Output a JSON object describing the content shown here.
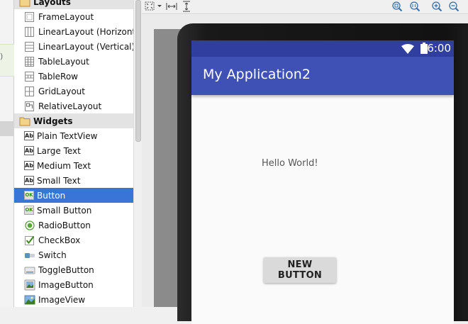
{
  "left_strip": {
    "fragment": ")"
  },
  "palette": {
    "rows": [
      {
        "label": "Layouts",
        "type": "group",
        "icon": "folder-icon"
      },
      {
        "label": "FrameLayout",
        "type": "item",
        "icon": "frame-layout-icon"
      },
      {
        "label": "LinearLayout (Horizonta",
        "type": "item",
        "icon": "linear-layout-horizontal-icon"
      },
      {
        "label": "LinearLayout (Vertical)",
        "type": "item",
        "icon": "linear-layout-vertical-icon"
      },
      {
        "label": "TableLayout",
        "type": "item",
        "icon": "table-layout-icon"
      },
      {
        "label": "TableRow",
        "type": "item",
        "icon": "table-row-icon"
      },
      {
        "label": "GridLayout",
        "type": "item",
        "icon": "grid-layout-icon"
      },
      {
        "label": "RelativeLayout",
        "type": "item",
        "icon": "relative-layout-icon"
      },
      {
        "label": "Widgets",
        "type": "group",
        "icon": "folder-icon"
      },
      {
        "label": "Plain TextView",
        "type": "item",
        "icon": "textview-icon"
      },
      {
        "label": "Large Text",
        "type": "item",
        "icon": "textview-icon"
      },
      {
        "label": "Medium Text",
        "type": "item",
        "icon": "textview-icon"
      },
      {
        "label": "Small Text",
        "type": "item",
        "icon": "textview-icon"
      },
      {
        "label": "Button",
        "type": "item",
        "icon": "button-icon",
        "selected": true
      },
      {
        "label": "Small Button",
        "type": "item",
        "icon": "small-button-icon"
      },
      {
        "label": "RadioButton",
        "type": "item",
        "icon": "radio-button-icon"
      },
      {
        "label": "CheckBox",
        "type": "item",
        "icon": "checkbox-icon"
      },
      {
        "label": "Switch",
        "type": "item",
        "icon": "switch-icon"
      },
      {
        "label": "ToggleButton",
        "type": "item",
        "icon": "toggle-button-icon"
      },
      {
        "label": "ImageButton",
        "type": "item",
        "icon": "image-button-icon"
      },
      {
        "label": "ImageView",
        "type": "item",
        "icon": "image-view-icon"
      }
    ],
    "icon_text": {
      "ab": "Ab",
      "ok": "OK"
    }
  },
  "toolbar": {
    "icons": [
      "fit-screen-icon",
      "swap-horizontal-icon",
      "swap-vertical-icon",
      "zoom-to-fit-icon",
      "zoom-actual-icon",
      "zoom-in-icon",
      "zoom-out-icon"
    ]
  },
  "device": {
    "status_time": "6:00",
    "app_title": "My Application2",
    "hello_text": "Hello World!",
    "button_label": "NEW BUTTON"
  },
  "colors": {
    "selection": "#3875d7",
    "status_bar": "#303f9f",
    "app_bar": "#3f51b5"
  }
}
